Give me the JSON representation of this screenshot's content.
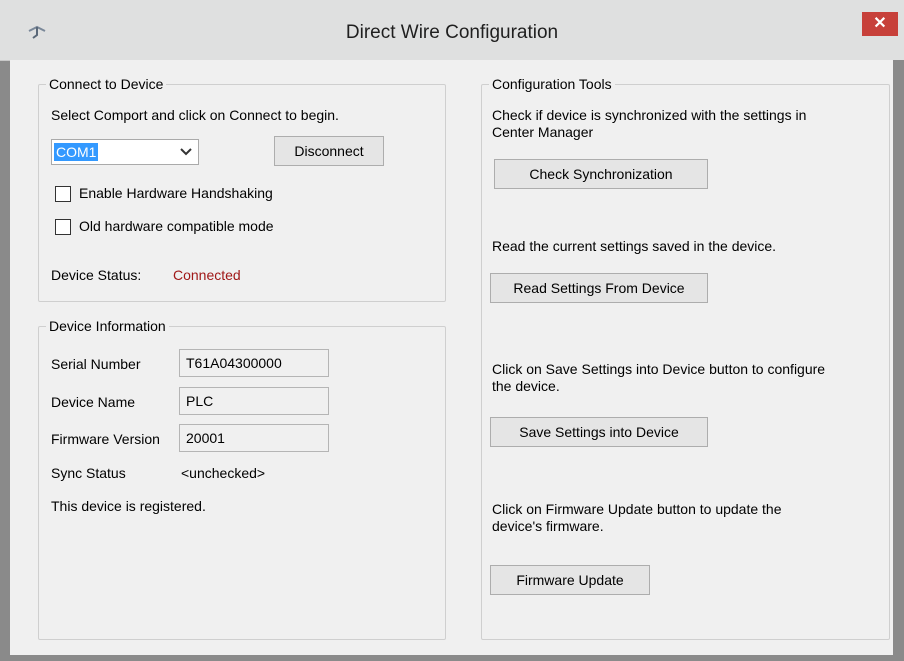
{
  "window": {
    "title": "Direct Wire Configuration",
    "close_label": "✕"
  },
  "connect_group": {
    "title": "Connect to Device",
    "instruction": "Select Comport and click on Connect to begin.",
    "comport_value": "COM1",
    "disconnect_label": "Disconnect",
    "handshaking_label": "Enable Hardware Handshaking",
    "handshaking_checked": false,
    "old_hw_label": "Old hardware compatible mode",
    "old_hw_checked": false,
    "status_label": "Device Status:",
    "status_value": "Connected",
    "status_color": "#a01818"
  },
  "device_info": {
    "title": "Device Information",
    "serial_label": "Serial Number",
    "serial_value": "T61A04300000",
    "name_label": "Device Name",
    "name_value": "PLC",
    "firmware_label": "Firmware Version",
    "firmware_value": "20001",
    "sync_label": "Sync Status",
    "sync_value": "<unchecked>",
    "registered_text": "This device is registered."
  },
  "config_tools": {
    "title": "Configuration Tools",
    "sync_desc_line1": "Check if device is synchronized with the settings in",
    "sync_desc_line2": "Center Manager",
    "check_sync_label": "Check Synchronization",
    "read_desc": "Read the current settings saved in the device.",
    "read_label": "Read Settings From Device",
    "save_desc_line1": "Click on Save Settings into Device button to configure",
    "save_desc_line2": "the device.",
    "save_label": "Save Settings into Device",
    "fw_desc_line1": "Click on Firmware Update button to update the",
    "fw_desc_line2": "device's firmware.",
    "fw_label": "Firmware Update"
  },
  "colors": {
    "accent_selection": "#3399ff",
    "close_button": "#c7403a"
  }
}
